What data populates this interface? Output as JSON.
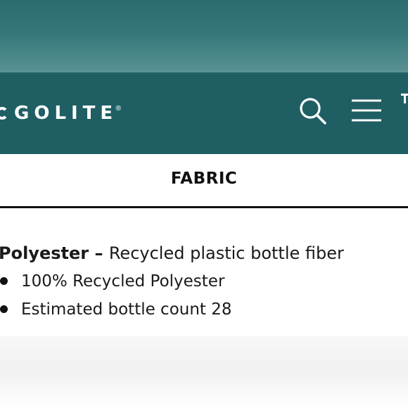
{
  "brand": {
    "logo_text": "GOLITE",
    "registered_mark": "®"
  },
  "header": {
    "search_icon": "search-icon",
    "menu_icon": "hamburger-menu-icon"
  },
  "section": {
    "title": "FABRIC"
  },
  "fabric": {
    "material": "Polyester",
    "separator": " – ",
    "description": "Recycled plastic bottle fiber",
    "details": [
      "100% Recycled Polyester",
      "Estimated bottle count 28"
    ]
  },
  "colors": {
    "header_bg": "#1f5f64",
    "top_band": "#34777a",
    "text": "#1a1a1a"
  }
}
